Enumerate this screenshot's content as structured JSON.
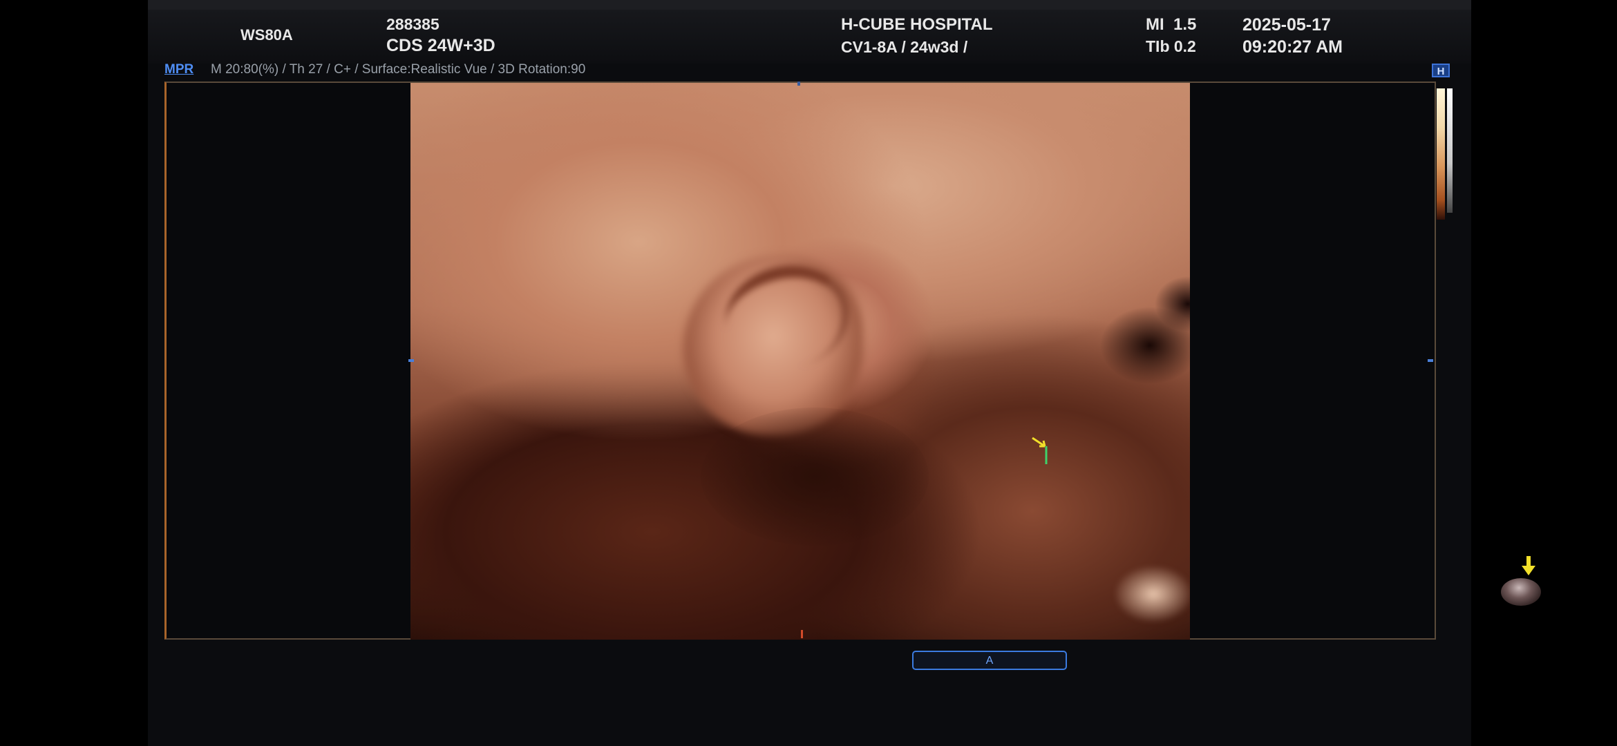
{
  "header": {
    "model": "WS80A",
    "patient_id": "288385",
    "study": "CDS 24W+3D",
    "hospital": "H-CUBE HOSPITAL",
    "probe_preset": "CV1-8A / 24w3d /",
    "mi": "MI  1.5",
    "tib": "TIb 0.2",
    "date": "2025-05-17",
    "time": "09:20:27 AM"
  },
  "subheader": {
    "mode": "MPR",
    "params": "M 20:80(%) / Th 27 / C+ / Surface:Realistic Vue / 3D Rotation:90"
  },
  "indicator": {
    "h_label": "H"
  },
  "view_button": {
    "label": "A"
  },
  "colors": {
    "accent_blue": "#3b7be0",
    "frame_orange": "#a8642a",
    "marker_yellow": "#f2e02a"
  }
}
